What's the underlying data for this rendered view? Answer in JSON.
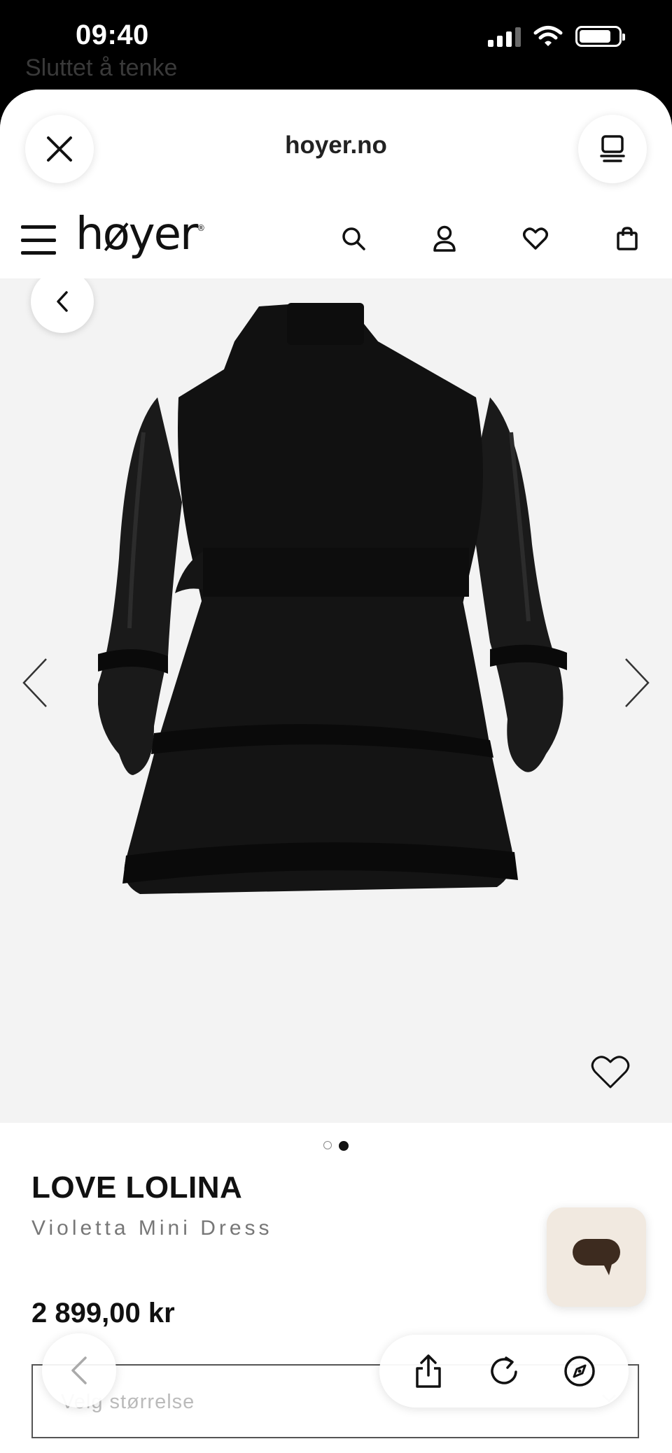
{
  "status_bar": {
    "time": "09:40",
    "ghost_text": "Sluttet å tenke"
  },
  "browser": {
    "url": "hoyer.no"
  },
  "site": {
    "logo_text": "høyer",
    "logo_mark": "®"
  },
  "product": {
    "brand": "LOVE LOLINA",
    "name": "Violetta Mini Dress",
    "price": "2 899,00 kr",
    "size_placeholder": "Velg størrelse",
    "image_count": 2,
    "active_image": 2
  },
  "icons": {
    "close": "close-icon",
    "tabs": "tabs-icon",
    "menu": "hamburger-icon",
    "search": "search-icon",
    "account": "user-icon",
    "wishlist": "heart-icon",
    "bag": "bag-icon",
    "share": "share-icon",
    "reload": "reload-icon",
    "compass": "compass-icon"
  },
  "colors": {
    "chat_bg": "#f1e9e0",
    "chat_icon": "#3d2b1f",
    "image_bg": "#f3f3f3"
  }
}
